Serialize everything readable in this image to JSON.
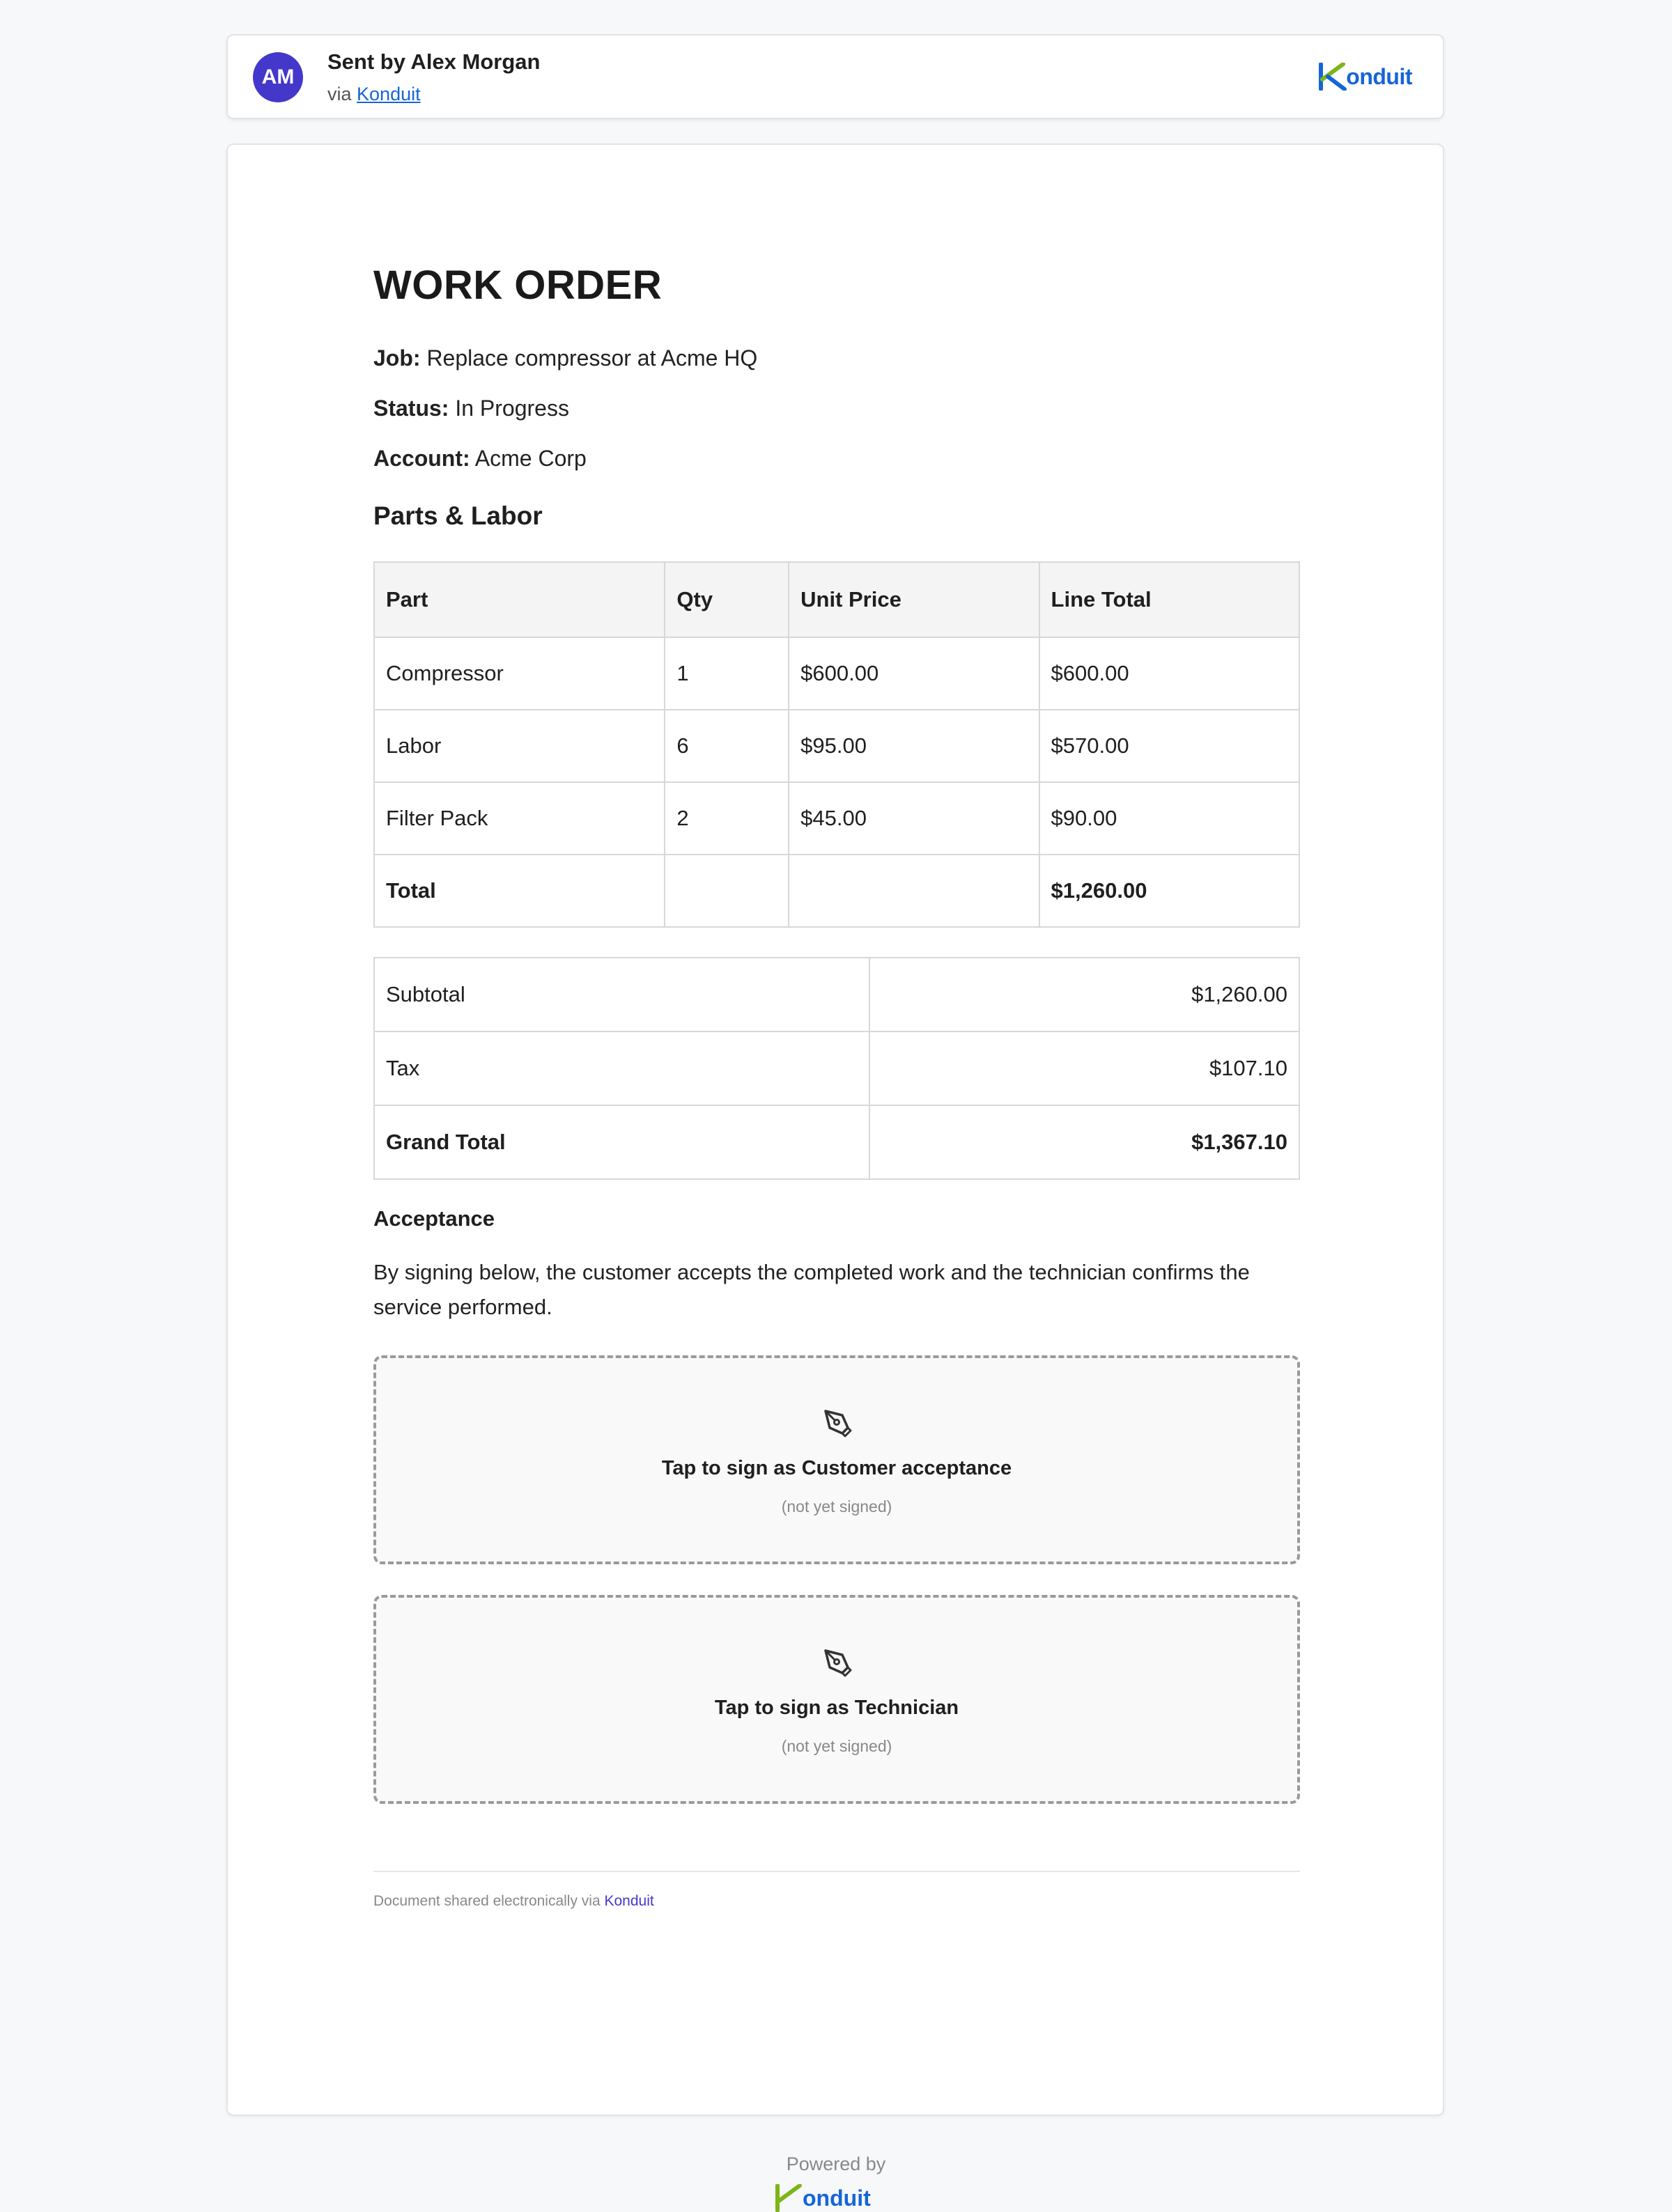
{
  "sender": {
    "initials": "AM",
    "title": "Sent by Alex Morgan",
    "via_prefix": "via",
    "via_link": "Konduit"
  },
  "brand": {
    "name": "onduit",
    "accent_color": "#1565d8",
    "mark_color": "#7cb518"
  },
  "document": {
    "title": "WORK ORDER",
    "fields": [
      {
        "label": "Job:",
        "value": "Replace compressor at Acme HQ"
      },
      {
        "label": "Status:",
        "value": "In Progress"
      },
      {
        "label": "Account:",
        "value": "Acme Corp"
      }
    ],
    "parts_heading": "Parts & Labor",
    "parts_table": {
      "headers": [
        "Part",
        "Qty",
        "Unit Price",
        "Line Total"
      ],
      "rows": [
        [
          "Compressor",
          "1",
          "$600.00",
          "$600.00"
        ],
        [
          "Labor",
          "6",
          "$95.00",
          "$570.00"
        ],
        [
          "Filter Pack",
          "2",
          "$45.00",
          "$90.00"
        ]
      ],
      "total_row": [
        "Total",
        "",
        "",
        "$1,260.00"
      ]
    },
    "totals": [
      {
        "label": "Subtotal",
        "amount": "$1,260.00"
      },
      {
        "label": "Tax",
        "amount": "$107.10"
      },
      {
        "label": "Grand Total",
        "amount": "$1,367.10"
      }
    ],
    "acceptance_heading": "Acceptance",
    "acceptance_text": "By signing below, the customer accepts the completed work and the technician confirms the service performed.",
    "signatures": [
      {
        "label": "Tap to sign as Customer acceptance",
        "status": "(not yet signed)"
      },
      {
        "label": "Tap to sign as Technician",
        "status": "(not yet signed)"
      }
    ],
    "footer_prefix": "Document shared electronically via",
    "footer_link": "Konduit"
  },
  "powered_by": "Powered by"
}
